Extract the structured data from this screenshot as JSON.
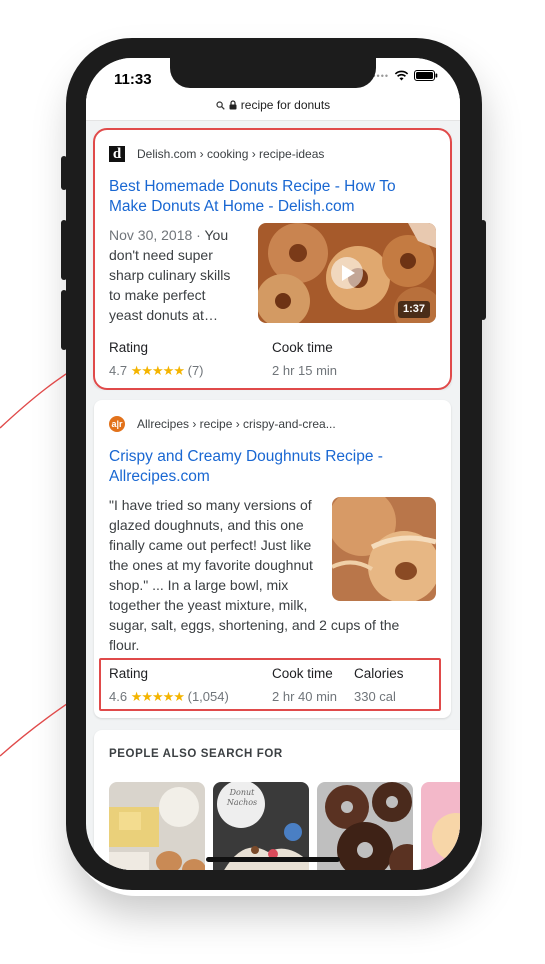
{
  "status": {
    "time": "11:33"
  },
  "browser": {
    "url": "recipe for donuts"
  },
  "results": [
    {
      "source": "Delish.com › cooking › recipe-ideas",
      "title_lines": [
        "Best Homemade Donuts Recipe - How To",
        "Make Donuts At Home - Delish.com"
      ],
      "date": "Nov 30, 2018 · ",
      "snippet_lines": [
        "Nov 30, 2018 · You",
        "don't need super",
        "sharp culinary skills",
        "to make perfect",
        "yeast donuts at…"
      ],
      "video_duration": "1:37",
      "rating_label": "Rating",
      "rating_value": "4.7",
      "rating_stars": "★★★★★",
      "rating_count": "(7)",
      "cook_label": "Cook time",
      "cook_value": "2 hr 15 min"
    },
    {
      "source": "Allrecipes › recipe › crispy-and-crea...",
      "title_lines": [
        "Crispy and Creamy Doughnuts Recipe -",
        "Allrecipes.com"
      ],
      "snippet_lines": [
        "\"I have tried so many versions of",
        "glazed doughnuts, and this one",
        "finally came out perfect! Just like",
        "the ones at my favorite doughnut",
        "shop.\" ... In a large bowl, mix",
        "together the yeast mixture, milk,",
        "sugar, salt, eggs, shortening, and 2 cups of the",
        "flour."
      ],
      "rating_label": "Rating",
      "rating_value": "4.6",
      "rating_stars": "★★★★★",
      "rating_count": "(1,054)",
      "cook_label": "Cook time",
      "cook_value": "2 hr 40 min",
      "calories_label": "Calories",
      "calories_value": "330 cal"
    }
  ],
  "people_also_search": {
    "title": "PEOPLE ALSO SEARCH FOR",
    "tile2_caption": "Donut Nachos"
  },
  "colors": {
    "link": "#1967d2",
    "highlight": "#e04a4a",
    "star": "#f4b400"
  }
}
